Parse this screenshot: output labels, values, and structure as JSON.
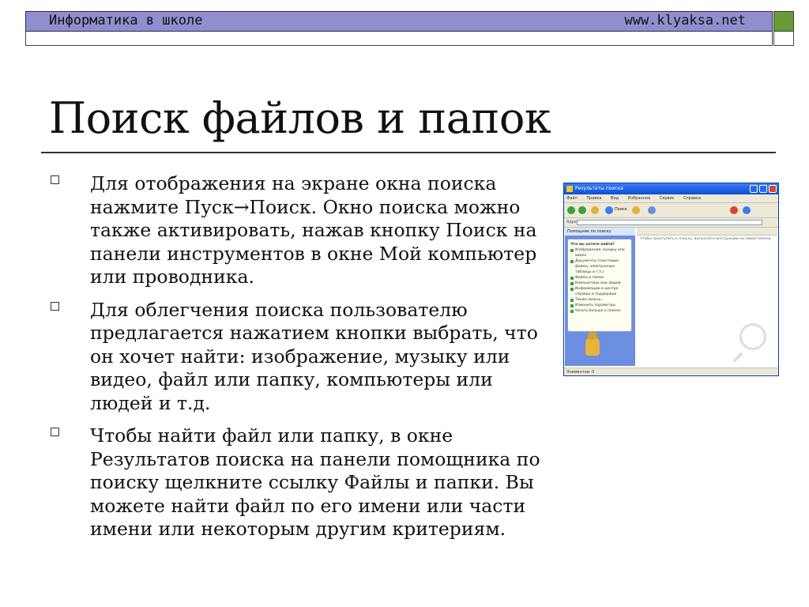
{
  "header": {
    "left_text": "Информатика в школе",
    "right_text": "www.klyaksa.net"
  },
  "slide": {
    "title": "Поиск файлов и папок",
    "bullets": [
      "Для отображения на экране окна поиска нажмите Пуск→Поиск. Окно поиска можно также активировать, нажав кнопку Поиск на панели инструментов в окне Мой компьютер или проводника.",
      "Для облегчения поиска пользователю предлагается нажатием кнопки выбрать, что он хочет найти: изображение, музыку или видео, файл или папку, компьютеры или людей и т.д.",
      "Чтобы найти файл или папку, в окне Результатов поиска на панели помощника по поиску щелкните ссылку Файлы и папки. Вы можете найти файл по его имени или части имени или некоторым другим критериям."
    ]
  },
  "screenshot": {
    "window_title": "Результаты поиска",
    "menu_items": [
      "Файл",
      "Правка",
      "Вид",
      "Избранное",
      "Сервис",
      "Справка"
    ],
    "search_button": "Поиск",
    "address_label": "Адрес",
    "pane_header": "Помощник по поиску",
    "pane_question": "Что вы хотите найти?",
    "pane_options": [
      "Изображения, музыку или видео",
      "Документы (текстовые файлы, электронные таблицы и т.п.)",
      "Файлы и папки",
      "Компьютеры или людей",
      "Информацию в центре справки и поддержки",
      "Также можно...",
      "Изменить параметры",
      "Узнать больше о поиске"
    ],
    "results_message": "Чтобы приступить к поиску, выполните инструкции на левой панели.",
    "status_text": "Элементов: 0",
    "colors": {
      "titlebar": "#0b4fd6",
      "pane": "#6c8ee0",
      "header_band": "#8f8fcf",
      "accent_square": "#6a9a3a"
    }
  }
}
